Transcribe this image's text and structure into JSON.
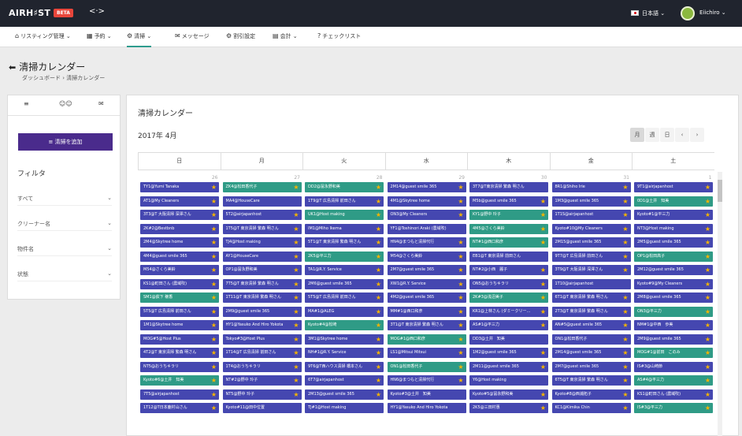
{
  "header": {
    "brand": "AIRH♯ST",
    "beta": "BETA",
    "swap_icon": "<·>",
    "language": "日本語 ⌄",
    "user": "Eiichiro ⌄"
  },
  "nav": [
    {
      "icon": "home-icon",
      "glyph": "⌂",
      "label": "リスティング管理 ⌄"
    },
    {
      "icon": "calendar-icon",
      "glyph": "▦",
      "label": "予約 ⌄"
    },
    {
      "icon": "broom-icon",
      "glyph": "⚙",
      "label": "清掃 ⌄"
    },
    {
      "icon": "chat-icon",
      "glyph": "✉",
      "label": "メッセージ"
    },
    {
      "icon": "gear-icon",
      "glyph": "⚙",
      "label": "割引設定"
    },
    {
      "icon": "ledger-icon",
      "glyph": "▤",
      "label": "会計 ⌄"
    },
    {
      "icon": "help-icon",
      "glyph": "?",
      "label": "チェックリスト"
    }
  ],
  "page": {
    "title": "清掃カレンダー",
    "breadcrumb": "ダッシュボード  ›  清掃カレンダー"
  },
  "sidebar": {
    "tabs": [
      "≡",
      "☺☺",
      "✉"
    ],
    "add_button": "清掃を追加",
    "filter_title": "フィルタ",
    "filters": [
      "すべて",
      "クリーナー名",
      "物件名",
      "状態"
    ]
  },
  "main": {
    "title": "清掃カレンダー",
    "month": "2017年 4月",
    "view_buttons": [
      "月",
      "週",
      "日",
      "‹",
      "›"
    ],
    "weekdays": [
      "日",
      "月",
      "火",
      "水",
      "木",
      "金",
      "土"
    ],
    "day_numbers": [
      "26",
      "27",
      "28",
      "29",
      "30",
      "31",
      "1"
    ]
  },
  "events": [
    [
      "TY1@Yumi Tanaka",
      "ZK4@松田香代子",
      "DD2@冨永野和美",
      "2M14@guest smile 365",
      "3T7@T東京清掃 繁森 明さん",
      "8R1@Shiho Irie",
      "9T1@airjapanhost"
    ],
    [
      "AT1@My Cleaners",
      "MA4@HouseCare",
      "1T9@T 広島清掃 前田さん",
      "4M1@Skytree home",
      "M5b@guest smile 365",
      "1M3@guest smile 365",
      "0D1@土井　知美"
    ],
    [
      "3T3@T 大阪清掃 深澤さん",
      "5T2@airjapanhost",
      "UK1@Host making",
      "ON3@My Cleaners",
      "KY1@野中 玲子",
      "1T1S@airjapanhost",
      "Kyoto#1@平三力"
    ],
    [
      "2K#2@Bestbnb",
      "1T5@T 東京清掃 繁森 明さん",
      "IM1@Miho Ikema",
      "YF1@Toshinori Araki (農域吹)",
      "4M5@さくら美鈴",
      "Kyoto#10@My Cleaners",
      "NT3@Host making"
    ],
    [
      "2M4@Skytree home",
      "TJ4@Host making",
      "5T1@T 東京清掃 繁森 明さん",
      "HN4@まつもと清掃代行",
      "NT#1@西口和彦",
      "2M15@guest smile 365",
      "2M5@guest smile 365"
    ],
    [
      "4M4@guest smile 365",
      "AY1@HouseCare",
      "2K5@平三力",
      "M54@さくら美鈴",
      "EB1@T 東京清掃 前田さん",
      "9T7@T 広島清掃 前田さん",
      "OP1@松田高子"
    ],
    [
      "M54@さくら美鈴",
      "OP1@冨永野和美",
      "TA1@R.Y. Service",
      "2M7@guest smile 365",
      "NT#2@小西　麗子",
      "3T9@T 大阪清掃 深澤さん",
      "2M12@guest smile 365"
    ],
    [
      "KS1@町田さん (農域吹)",
      "7T5@T 東京清掃 繁森 明さん",
      "2M6@guest smile 365",
      "XW1@R.Y. Service",
      "ON5@おうちキラリ",
      "1T10@airjapanhost",
      "Kyoto#9@My Cleaners"
    ],
    [
      "SM1@荻下 穣香",
      "1T11@T 東京清掃 繁森 明さん",
      "5T5@T 広島清掃 前田さん",
      "4M2@guest smile 365",
      "2K#3@浅沼美子",
      "6T1@T 東京清掃 繁森 明さん",
      "2M8@guest smile 365"
    ],
    [
      "5T5@T 広島清掃 前田さん",
      "2M9@guest smile 365",
      "MA#1@ALEG",
      "MM#1@西口和彦",
      "KR1@上林さん (ダミークリー…",
      "2T3@T 東京清掃 繁森 明さん",
      "ON3@平三力"
    ],
    [
      "1M1@Skytree home",
      "HY1@Yasuko And Hiro Yokota",
      "Kyoto#4@松崎",
      "3T1@T 東京清掃 繁森 明さん",
      "AS#1@平三力",
      "AN#5@guest smile 365",
      "NM#1@中西　歩美"
    ],
    [
      "MOG#5@Host Plus",
      "Tokyo#3@Host Plus",
      "3M1@Skytree home",
      "MOG#1@西口和彦",
      "DD3@土井　知美",
      "ON1@松田香代子",
      "2M9@guest smile 365"
    ],
    [
      "4T2@T 東京清掃 繁森 明さん",
      "1T14@T 広島清掃 前田さん",
      "NH#1@R.Y. Service",
      "LS1@Mitsui Mitsui",
      "1M2@guest smile 365",
      "2M14@guest smile 365",
      "MOG#1@前田　このみ"
    ],
    [
      "NT5@おうちキラリ",
      "1T4@おうちキラリ",
      "9T6@T西ハウス清掃 橋本さん",
      "ON1@松田香代子",
      "2M11@guest smile 365",
      "2M7@guest smile 365",
      "IS#3@山崎節"
    ],
    [
      "Kyoto#6@土井　知美",
      "NT#2@野中 玲子",
      "6T7@airjapanhost",
      "HN6@まつもと清掃代行",
      "Y6@Host making",
      "6T5@T 東京清掃 繁森 明さん",
      "AS#4@平三力"
    ],
    [
      "7T5@airjapanhost",
      "NT5@野中 玲子",
      "2M13@guest smile 365",
      "Kyoto#3@土井　知美",
      "Kyoto#5@冨永野和美",
      "Kyoto#8@西浦拓子",
      "KS1@町田さん (農域吹)"
    ],
    [
      "1T12@T日本鹿村山さん",
      "Kyoto#11@田中位置",
      "TJ#1@Host making",
      "HY1@Yasuko And Hiro Yokota",
      "2K5@三田村惠",
      "KC1@Kimika Chin",
      "IS#3@平三力"
    ]
  ],
  "teal_cells": [
    "0-1",
    "0-2",
    "1-6",
    "2-2",
    "2-4",
    "3-4",
    "4-4",
    "5-2",
    "5-6",
    "8-0",
    "8-4",
    "9-6",
    "10-2",
    "11-3",
    "12-6",
    "13-3",
    "14-0",
    "14-6",
    "16-6"
  ],
  "no_star_cells": [
    "0-4",
    "1-1",
    "3-3",
    "5-4",
    "7-5",
    "11-4",
    "14-4",
    "15-3",
    "16-1",
    "16-2",
    "16-3"
  ],
  "colors": {
    "purple": "#4547b0",
    "teal": "#2f9b86",
    "star": "#f4b400",
    "topbar": "#20242e",
    "accent": "#4a2b8c"
  }
}
